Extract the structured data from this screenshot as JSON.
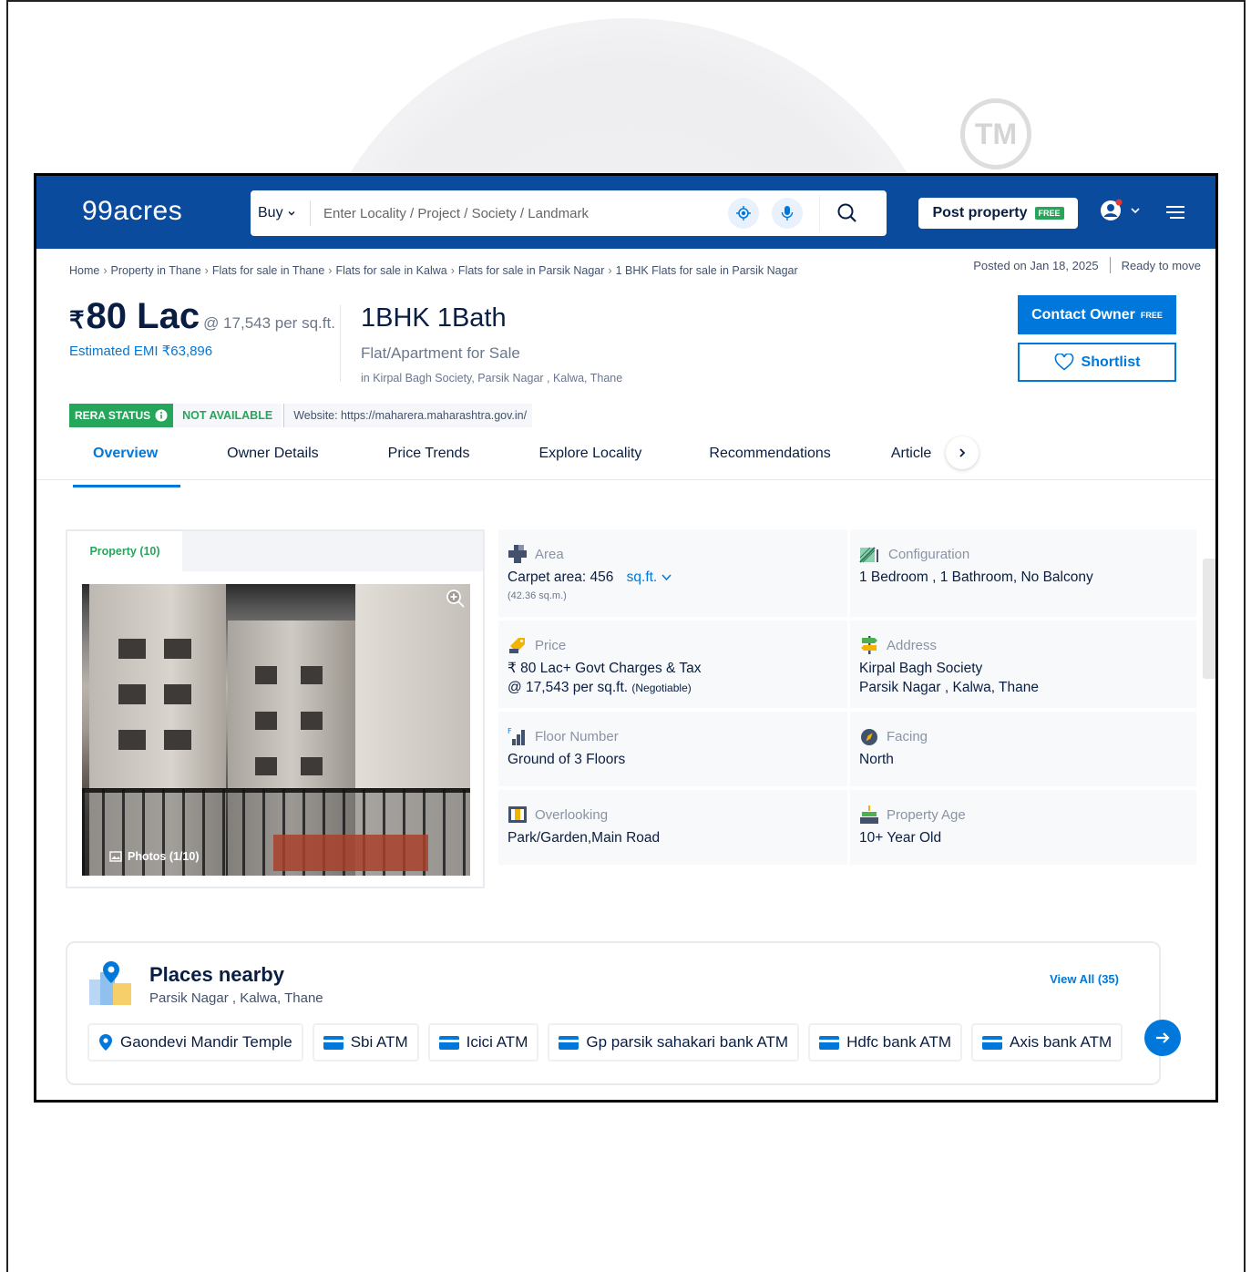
{
  "watermark": {
    "tm": "TM"
  },
  "header": {
    "logo": "99acres",
    "search": {
      "mode": "Buy",
      "placeholder": "Enter Locality / Project / Society / Landmark"
    },
    "post_property": "Post property",
    "free_tag": "FREE"
  },
  "breadcrumb": [
    "Home",
    "Property in Thane",
    "Flats for sale in Thane",
    "Flats for sale in Kalwa",
    "Flats for sale in Parsik Nagar",
    "1 BHK Flats for sale in Parsik Nagar"
  ],
  "posted": {
    "date": "Posted on Jan 18, 2025",
    "status": "Ready to move"
  },
  "listing": {
    "currency": "₹",
    "price": "80 Lac",
    "price_per_sqft": "@ 17,543 per sq.ft.",
    "emi": "Estimated EMI ₹63,896",
    "title": "1BHK 1Bath",
    "type": "Flat/Apartment for Sale",
    "location": "in Kirpal Bagh Society, Parsik Nagar , Kalwa, Thane"
  },
  "actions": {
    "contact": "Contact Owner",
    "contact_free": "FREE",
    "shortlist": "Shortlist"
  },
  "rera": {
    "label": "RERA STATUS",
    "status": "NOT AVAILABLE",
    "website": "Website: https://maharera.maharashtra.gov.in/"
  },
  "tabs": [
    "Overview",
    "Owner Details",
    "Price Trends",
    "Explore Locality",
    "Recommendations",
    "Article"
  ],
  "photos": {
    "tab": "Property (10)",
    "count": "Photos (1/10)"
  },
  "details": {
    "area": {
      "label": "Area",
      "value": "Carpet area: 456",
      "unit": "sq.ft.",
      "sub": "(42.36 sq.m.)"
    },
    "configuration": {
      "label": "Configuration",
      "value": "1 Bedroom , 1 Bathroom, No Balcony"
    },
    "price": {
      "label": "Price",
      "value": "₹ 80 Lac+ Govt Charges & Tax",
      "value2": "@ 17,543 per sq.ft.",
      "negotiable": "(Negotiable)"
    },
    "address": {
      "label": "Address",
      "value": "Kirpal Bagh Society",
      "value2": "Parsik Nagar , Kalwa, Thane"
    },
    "floor": {
      "label": "Floor Number",
      "value": "Ground of 3 Floors"
    },
    "facing": {
      "label": "Facing",
      "value": "North"
    },
    "overlooking": {
      "label": "Overlooking",
      "value": "Park/Garden,Main Road"
    },
    "age": {
      "label": "Property Age",
      "value": "10+ Year Old"
    }
  },
  "places": {
    "title": "Places nearby",
    "subtitle": "Parsik Nagar , Kalwa, Thane",
    "view_all": "View All (35)",
    "items": [
      "Gaondevi Mandir Temple",
      "Sbi ATM",
      "Icici ATM",
      "Gp parsik sahakari bank ATM",
      "Hdfc bank ATM",
      "Axis bank ATM"
    ]
  },
  "colors": {
    "brand": "#0b4b9e",
    "accent": "#0078db",
    "green": "#26a65b"
  }
}
